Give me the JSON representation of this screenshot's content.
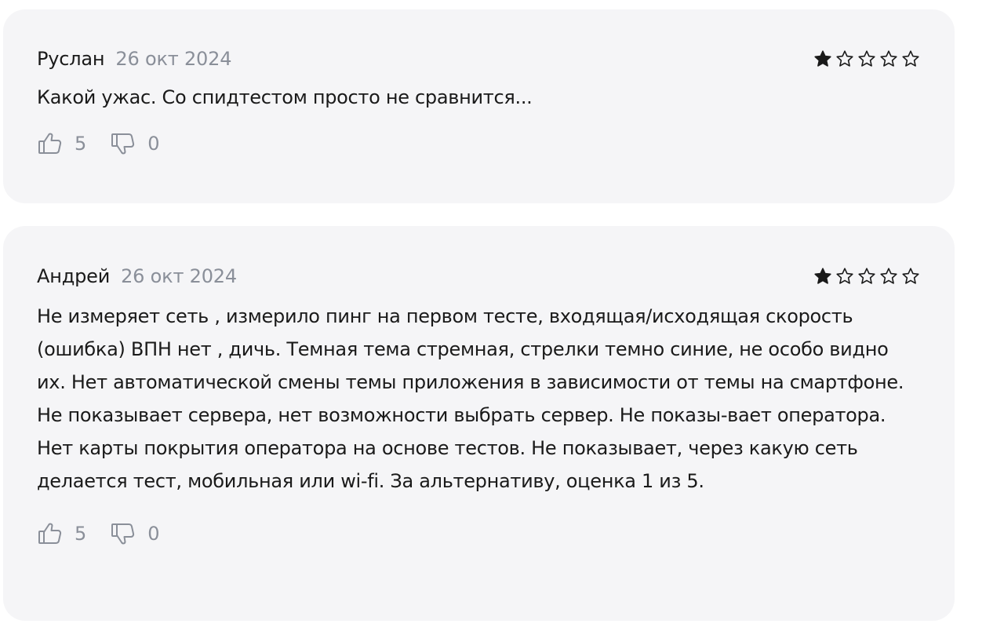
{
  "reviews": [
    {
      "author": "Руслан",
      "date": "26 окт 2024",
      "rating": 1,
      "rating_max": 5,
      "text": "Какой ужас. Со спидтестом просто не сравнится...",
      "likes": "5",
      "dislikes": "0"
    },
    {
      "author": "Андрей",
      "date": "26 окт 2024",
      "rating": 1,
      "rating_max": 5,
      "text": "Не измеряет сеть , измерило пинг на первом тесте, входящая/исходящая скорость (ошибка) ВПН нет , дичь. Темная тема стремная, стрелки темно синие, не особо видно их. Нет автоматической смены темы приложения в зависимости от темы на смартфоне. Не показывает сервера, нет возможности выбрать сервер. Не показы-вает оператора. Нет карты покрытия оператора на основе тестов. Не показывает, через какую сеть делается тест, мобильная или wi-fi. За альтернативу, оценка 1 из 5.",
      "likes": "5",
      "dislikes": "0"
    }
  ],
  "icons": {
    "like": "thumbs-up-icon",
    "dislike": "thumbs-down-icon",
    "star_filled": "star-filled-icon",
    "star_empty": "star-outline-icon"
  },
  "colors": {
    "card_background": "#f5f5f7",
    "text": "#1a1a1a",
    "muted": "#8a8f99"
  }
}
